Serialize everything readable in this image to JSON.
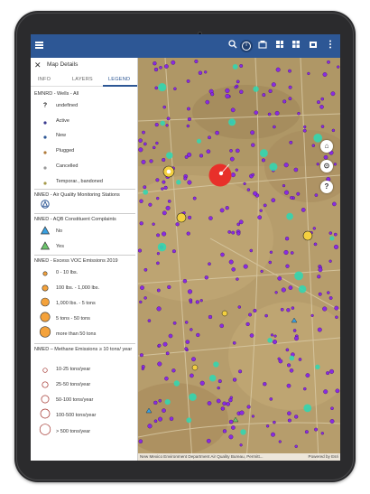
{
  "toolbar": {
    "menu_icon": "hamburger-icon",
    "icons": [
      "search-icon",
      "info-icon",
      "basemap-icon",
      "layers-icon",
      "grid-icon",
      "print-icon",
      "more-icon"
    ]
  },
  "panel": {
    "title": "Map Details",
    "tabs": [
      {
        "label": "INFO",
        "active": false
      },
      {
        "label": "LAYERS",
        "active": false
      },
      {
        "label": "LEGEND",
        "active": true
      }
    ]
  },
  "legend": {
    "wells": {
      "title": "EMNRD - Wells - All",
      "items": [
        {
          "label": "undefined",
          "symbol": "question-mark",
          "color": "#222222"
        },
        {
          "label": "Active",
          "symbol": "dot",
          "color": "#3a3a8f"
        },
        {
          "label": "New",
          "symbol": "dot",
          "color": "#2d5795"
        },
        {
          "label": "Plugged",
          "symbol": "dot",
          "color": "#b07a3a"
        },
        {
          "label": "Cancelled",
          "symbol": "dot",
          "color": "#999999"
        },
        {
          "label": "Temporar., bandoned",
          "symbol": "dot",
          "color": "#a59a4a"
        }
      ]
    },
    "air_quality": {
      "title": "NMED - Air Quality Monitoring Stations",
      "symbol": "monitoring-station-icon",
      "color": "#2d5795"
    },
    "complaints": {
      "title": "NMED - AQB Constituent Complaints",
      "items": [
        {
          "label": "No",
          "symbol": "triangle",
          "color": "#3aa0e0"
        },
        {
          "label": "Yes",
          "symbol": "triangle",
          "color": "#6bc46b"
        }
      ]
    },
    "voc": {
      "title": "NMED - Excess VOC Emissions 2019",
      "color": "#f4a23b",
      "items": [
        {
          "label": "0 - 10 lbs."
        },
        {
          "label": "100 lbs. - 1,000 lbs."
        },
        {
          "label": "1,000 lbs. - 5 tons"
        },
        {
          "label": "5 tons - 50 tons"
        },
        {
          "label": "more than 50 tons"
        }
      ]
    },
    "methane": {
      "title": "NMED – Methane Emissions ≥ 10 tons/ year",
      "color": "#a0302a",
      "items": [
        {
          "label": "10-25 tons/year"
        },
        {
          "label": "25-50 tons/year"
        },
        {
          "label": "50-100 tons/year"
        },
        {
          "label": "100-500 tons/year"
        },
        {
          "label": "> 500 tons/year"
        }
      ]
    }
  },
  "map": {
    "controls": [
      "home-icon",
      "locate-icon",
      "help-icon"
    ],
    "attribution": "New Mexico Environment Department Air Quality Bureau, Permitt...",
    "powered_by": "Powered by Esri",
    "colors": {
      "well": "#8a2be2",
      "monitor": "#33d6b0",
      "voc": "#f4d03f",
      "methane": "#e8302a"
    }
  }
}
